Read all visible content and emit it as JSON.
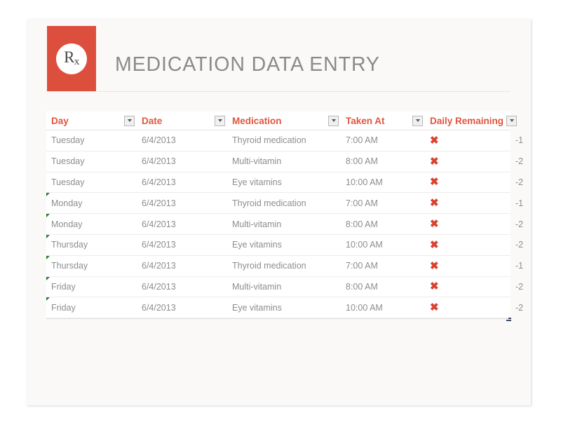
{
  "header": {
    "logo": {
      "icon": "rx-prescription-icon",
      "text": "R",
      "subscript": "x",
      "tile_color": "#dd4f3d"
    },
    "title": "MEDICATION DATA ENTRY"
  },
  "table": {
    "columns": [
      {
        "label": "Day",
        "filter_icon": "chevron-down-icon"
      },
      {
        "label": "Date",
        "filter_icon": "chevron-down-icon"
      },
      {
        "label": "Medication",
        "filter_icon": "chevron-down-icon"
      },
      {
        "label": "Taken At",
        "filter_icon": "chevron-down-icon"
      },
      {
        "label": "Daily Remaining",
        "filter_icon": "chevron-down-icon"
      }
    ],
    "check_icon": "x-mark-icon",
    "rows": [
      {
        "day": "Tuesday",
        "date": "6/4/2013",
        "medication": "Thyroid medication",
        "taken_at": "7:00 AM",
        "taken": "✖",
        "daily_remaining": "-1",
        "flagged": false
      },
      {
        "day": "Tuesday",
        "date": "6/4/2013",
        "medication": "Multi-vitamin",
        "taken_at": "8:00 AM",
        "taken": "✖",
        "daily_remaining": "-2",
        "flagged": false
      },
      {
        "day": "Tuesday",
        "date": "6/4/2013",
        "medication": "Eye vitamins",
        "taken_at": "10:00 AM",
        "taken": "✖",
        "daily_remaining": "-2",
        "flagged": false
      },
      {
        "day": "Monday",
        "date": "6/4/2013",
        "medication": "Thyroid medication",
        "taken_at": "7:00 AM",
        "taken": "✖",
        "daily_remaining": "-1",
        "flagged": true
      },
      {
        "day": "Monday",
        "date": "6/4/2013",
        "medication": "Multi-vitamin",
        "taken_at": "8:00 AM",
        "taken": "✖",
        "daily_remaining": "-2",
        "flagged": true
      },
      {
        "day": "Thursday",
        "date": "6/4/2013",
        "medication": "Eye vitamins",
        "taken_at": "10:00 AM",
        "taken": "✖",
        "daily_remaining": "-2",
        "flagged": true
      },
      {
        "day": "Thursday",
        "date": "6/4/2013",
        "medication": "Thyroid medication",
        "taken_at": "7:00 AM",
        "taken": "✖",
        "daily_remaining": "-1",
        "flagged": true
      },
      {
        "day": "Friday",
        "date": "6/4/2013",
        "medication": "Multi-vitamin",
        "taken_at": "8:00 AM",
        "taken": "✖",
        "daily_remaining": "-2",
        "flagged": true
      },
      {
        "day": "Friday",
        "date": "6/4/2013",
        "medication": "Eye vitamins",
        "taken_at": "10:00 AM",
        "taken": "✖",
        "daily_remaining": "-2",
        "flagged": true
      }
    ]
  },
  "colors": {
    "accent_red": "#dd4f3d",
    "header_text": "#e2553c",
    "title_gray": "#8a8a8a",
    "body_text": "#8d8d8d",
    "card_bg": "#faf9f7",
    "flag_green": "#2e7d32",
    "handle_navy": "#3f4a6b"
  }
}
